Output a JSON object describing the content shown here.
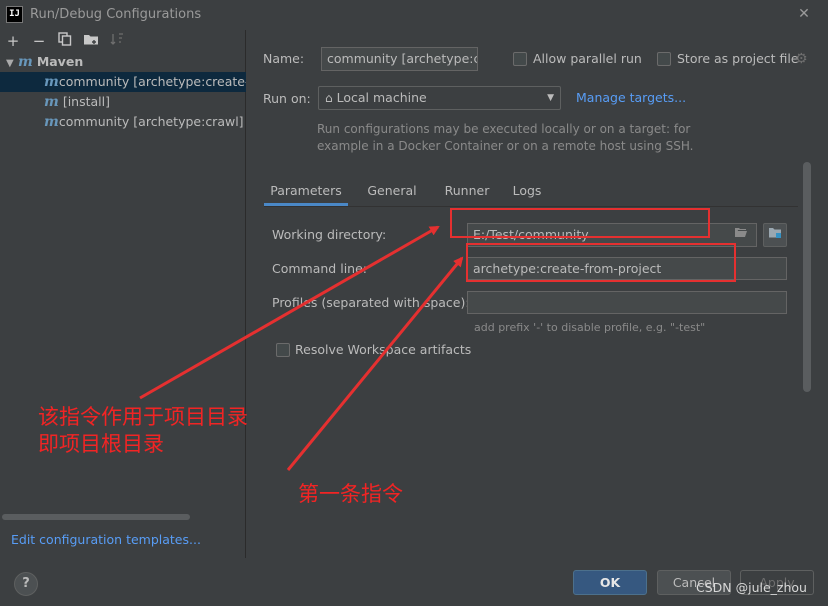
{
  "window": {
    "title": "Run/Debug Configurations",
    "app_icon": "IJ",
    "close_icon": "close-icon"
  },
  "toolbar": {
    "add": "+",
    "remove": "−",
    "copy": "copy-icon",
    "folder": "folder-icon",
    "sort": "sort-icon"
  },
  "tree": {
    "group": "Maven",
    "items": [
      {
        "label": "community [archetype:create-from-project]",
        "selected": true
      },
      {
        "label": "[install]",
        "selected": false
      },
      {
        "label": "community [archetype:crawl]",
        "selected": false
      }
    ]
  },
  "left_footer": {
    "edit_templates": "Edit configuration templates..."
  },
  "form": {
    "name_label": "Name:",
    "name_value": "community [archetype:create-from-project]",
    "allow_parallel": "Allow parallel run",
    "store_project": "Store as project file",
    "run_on_label": "Run on:",
    "run_on_value": "Local machine",
    "manage_targets": "Manage targets...",
    "hint_line1": "Run configurations may be executed locally or on a target: for",
    "hint_line2": "example in a Docker Container or on a remote host using SSH."
  },
  "tabs": [
    {
      "label": "Parameters",
      "active": true
    },
    {
      "label": "General",
      "active": false
    },
    {
      "label": "Runner",
      "active": false
    },
    {
      "label": "Logs",
      "active": false
    }
  ],
  "parameters": {
    "working_dir_label": "Working directory:",
    "working_dir_value": "E:/Test/community",
    "command_line_label": "Command line:",
    "command_line_value": "archetype:create-from-project",
    "profiles_label": "Profiles (separated with space):",
    "profiles_value": "",
    "profiles_hint": "add prefix '-' to disable profile, e.g. \"-test\"",
    "resolve_workspace": "Resolve Workspace artifacts"
  },
  "buttons": {
    "help": "?",
    "ok": "OK",
    "cancel": "Cancel",
    "apply": "Apply"
  },
  "watermark": "CSDN @jule_zhou",
  "annotations": {
    "note1_line1": "该指令作用于项目目录",
    "note1_line2": "即项目根目录",
    "note2": "第一条指令",
    "color": "#e53030"
  }
}
